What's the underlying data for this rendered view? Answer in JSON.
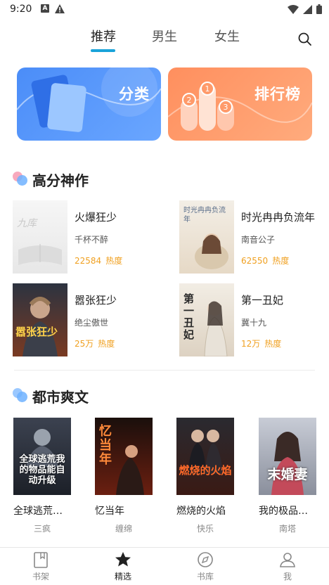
{
  "status_bar": {
    "time": "9:20",
    "a_icon_letter": "A"
  },
  "top_tabs": {
    "items": [
      {
        "label": "推荐",
        "active": true
      },
      {
        "label": "男生",
        "active": false
      },
      {
        "label": "女生",
        "active": false
      }
    ],
    "accent": "#1aa3d9"
  },
  "banners": {
    "category": {
      "label": "分类",
      "color": "#4b8df8"
    },
    "ranking": {
      "label": "排行榜",
      "color": "#ff8f5e"
    }
  },
  "section_top": {
    "title": "高分神作",
    "books": [
      {
        "title": "火爆狂少",
        "author": "千杯不醉",
        "heat": "22584",
        "heat_label": "热度"
      },
      {
        "title": "时光冉冉负流年",
        "author": "南音公子",
        "heat": "62550",
        "heat_label": "热度"
      },
      {
        "title": "嚣张狂少",
        "author": "绝尘傲世",
        "heat": "25万",
        "heat_label": "热度"
      },
      {
        "title": "第一丑妃",
        "author": "冀十九",
        "heat": "12万",
        "heat_label": "热度"
      }
    ]
  },
  "section_city": {
    "title": "都市爽文",
    "books": [
      {
        "title": "全球逃荒：我的物品能自动升级",
        "display_title": "全球逃荒…",
        "author": "三疯"
      },
      {
        "title": "忆当年",
        "display_title": "忆当年",
        "author": "缠绵"
      },
      {
        "title": "燃烧的火焰",
        "display_title": "燃烧的火焰",
        "author": "快乐"
      },
      {
        "title": "我的极品末婚妻",
        "display_title": "我的极品…",
        "author": "南塔"
      }
    ]
  },
  "cover_text": {
    "b1": "九库",
    "b2": "时光冉冉负流年",
    "b3": "嚣张狂少",
    "b4": "第一丑妃",
    "g1": "全球逃荒我的物品能自动升级",
    "g2": "忆当年",
    "g3": "燃烧的火焰",
    "g4": "末婚妻"
  },
  "bottom_nav": {
    "items": [
      {
        "label": "书架",
        "icon": "bookshelf-icon"
      },
      {
        "label": "精选",
        "icon": "star-icon",
        "active": true
      },
      {
        "label": "书库",
        "icon": "compass-icon"
      },
      {
        "label": "我",
        "icon": "user-icon"
      }
    ]
  }
}
